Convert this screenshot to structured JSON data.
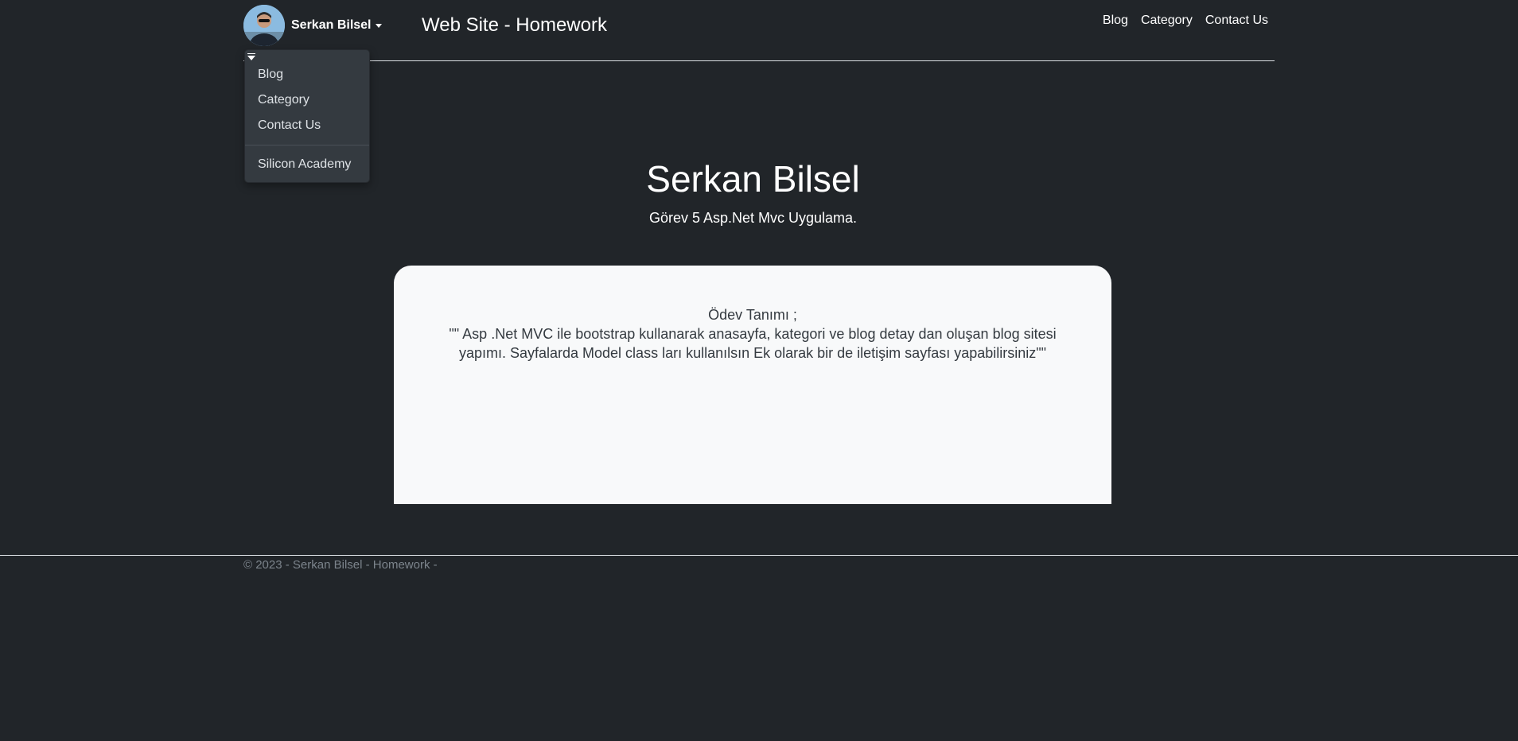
{
  "header": {
    "profile_name": "Serkan Bilsel",
    "site_title": "Web Site - Homework",
    "nav": [
      {
        "label": "Blog"
      },
      {
        "label": "Category"
      },
      {
        "label": "Contact Us"
      }
    ]
  },
  "dropdown": {
    "items": [
      {
        "label": "Blog"
      },
      {
        "label": "Category"
      },
      {
        "label": "Contact Us"
      },
      {
        "label": "Silicon Academy"
      }
    ]
  },
  "hero": {
    "title": "Serkan Bilsel",
    "subtitle": "Görev 5 Asp.Net Mvc Uygulama."
  },
  "card": {
    "heading": "Ödev Tanımı ;",
    "text": "\"\" Asp .Net MVC ile bootstrap kullanarak anasayfa, kategori ve blog detay dan oluşan blog sitesi yapımı. Sayfalarda Model class ları kullanılsın Ek olarak bir de iletişim sayfası yapabilirsiniz\"\""
  },
  "footer": {
    "text": "© 2023 - Serkan Bilsel - Homework -"
  },
  "colors": {
    "background": "#212529",
    "card_background": "#f8f9fa",
    "dropdown_background": "#343a40",
    "footer_text": "#7c848c"
  }
}
